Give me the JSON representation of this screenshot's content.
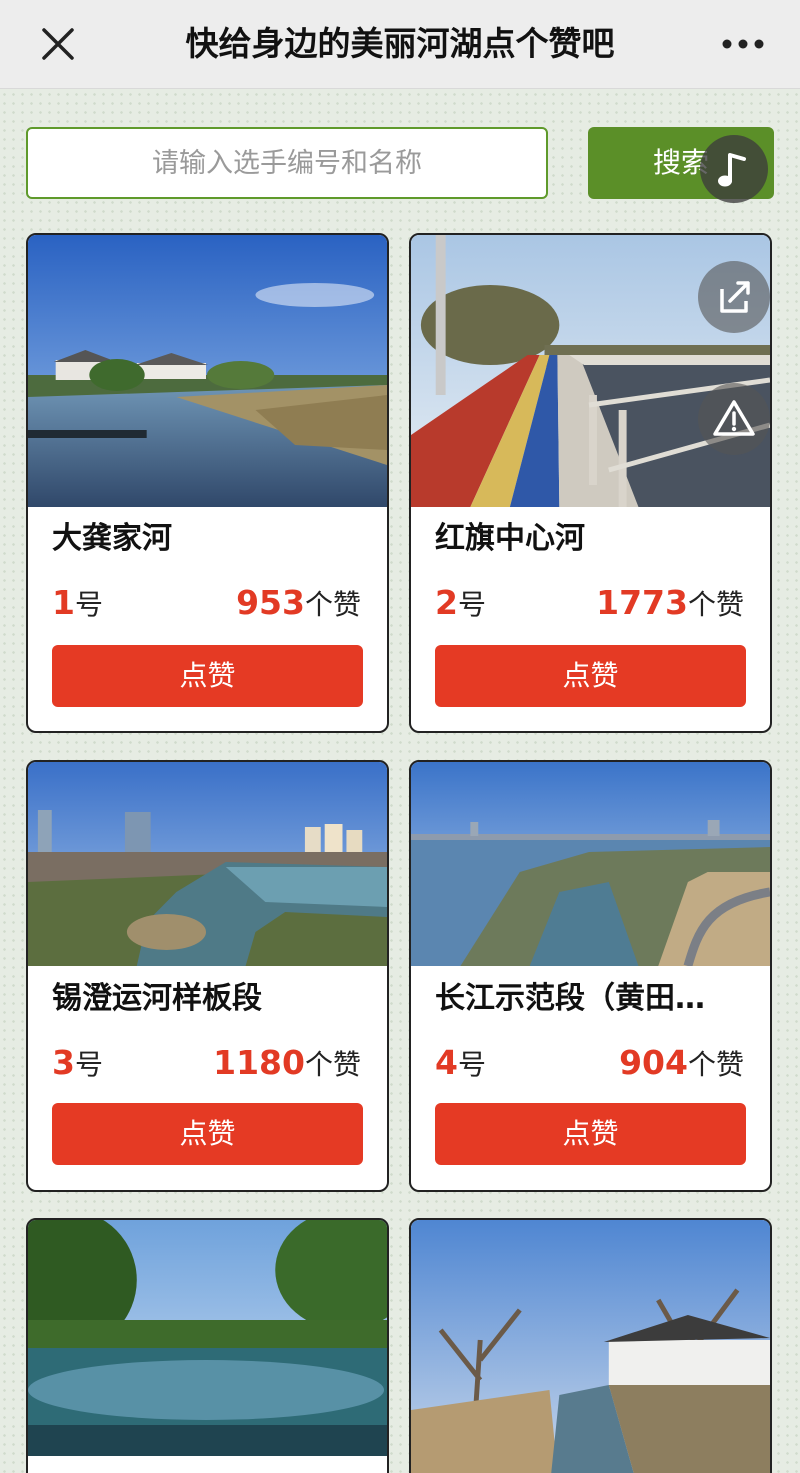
{
  "nav": {
    "title": "快给身边的美丽河湖点个赞吧",
    "close_icon": "close-icon",
    "more_icon": "more-dots-icon"
  },
  "search": {
    "placeholder": "请输入选手编号和名称",
    "value": "",
    "button_label": "搜索"
  },
  "floating": {
    "music_icon": "music-note-icon",
    "share_icon": "share-icon",
    "report_icon": "warning-icon"
  },
  "colors": {
    "accent_green": "#5b8f28",
    "like_red": "#e53a24",
    "number_red": "#e23a24"
  },
  "cards": [
    {
      "name": "大龚家河",
      "number": "1",
      "number_suffix": "号",
      "likes": "953",
      "likes_suffix": "个赞",
      "button": "点赞"
    },
    {
      "name": "红旗中心河",
      "number": "2",
      "number_suffix": "号",
      "likes": "1773",
      "likes_suffix": "个赞",
      "button": "点赞"
    },
    {
      "name": "锡澄运河样板段",
      "number": "3",
      "number_suffix": "号",
      "likes": "1180",
      "likes_suffix": "个赞",
      "button": "点赞"
    },
    {
      "name": "长江示范段（黄田…",
      "number": "4",
      "number_suffix": "号",
      "likes": "904",
      "likes_suffix": "个赞",
      "button": "点赞"
    },
    {
      "name": "",
      "number": "",
      "number_suffix": "",
      "likes": "",
      "likes_suffix": "",
      "button": ""
    },
    {
      "name": "",
      "number": "",
      "number_suffix": "",
      "likes": "",
      "likes_suffix": "",
      "button": ""
    }
  ]
}
